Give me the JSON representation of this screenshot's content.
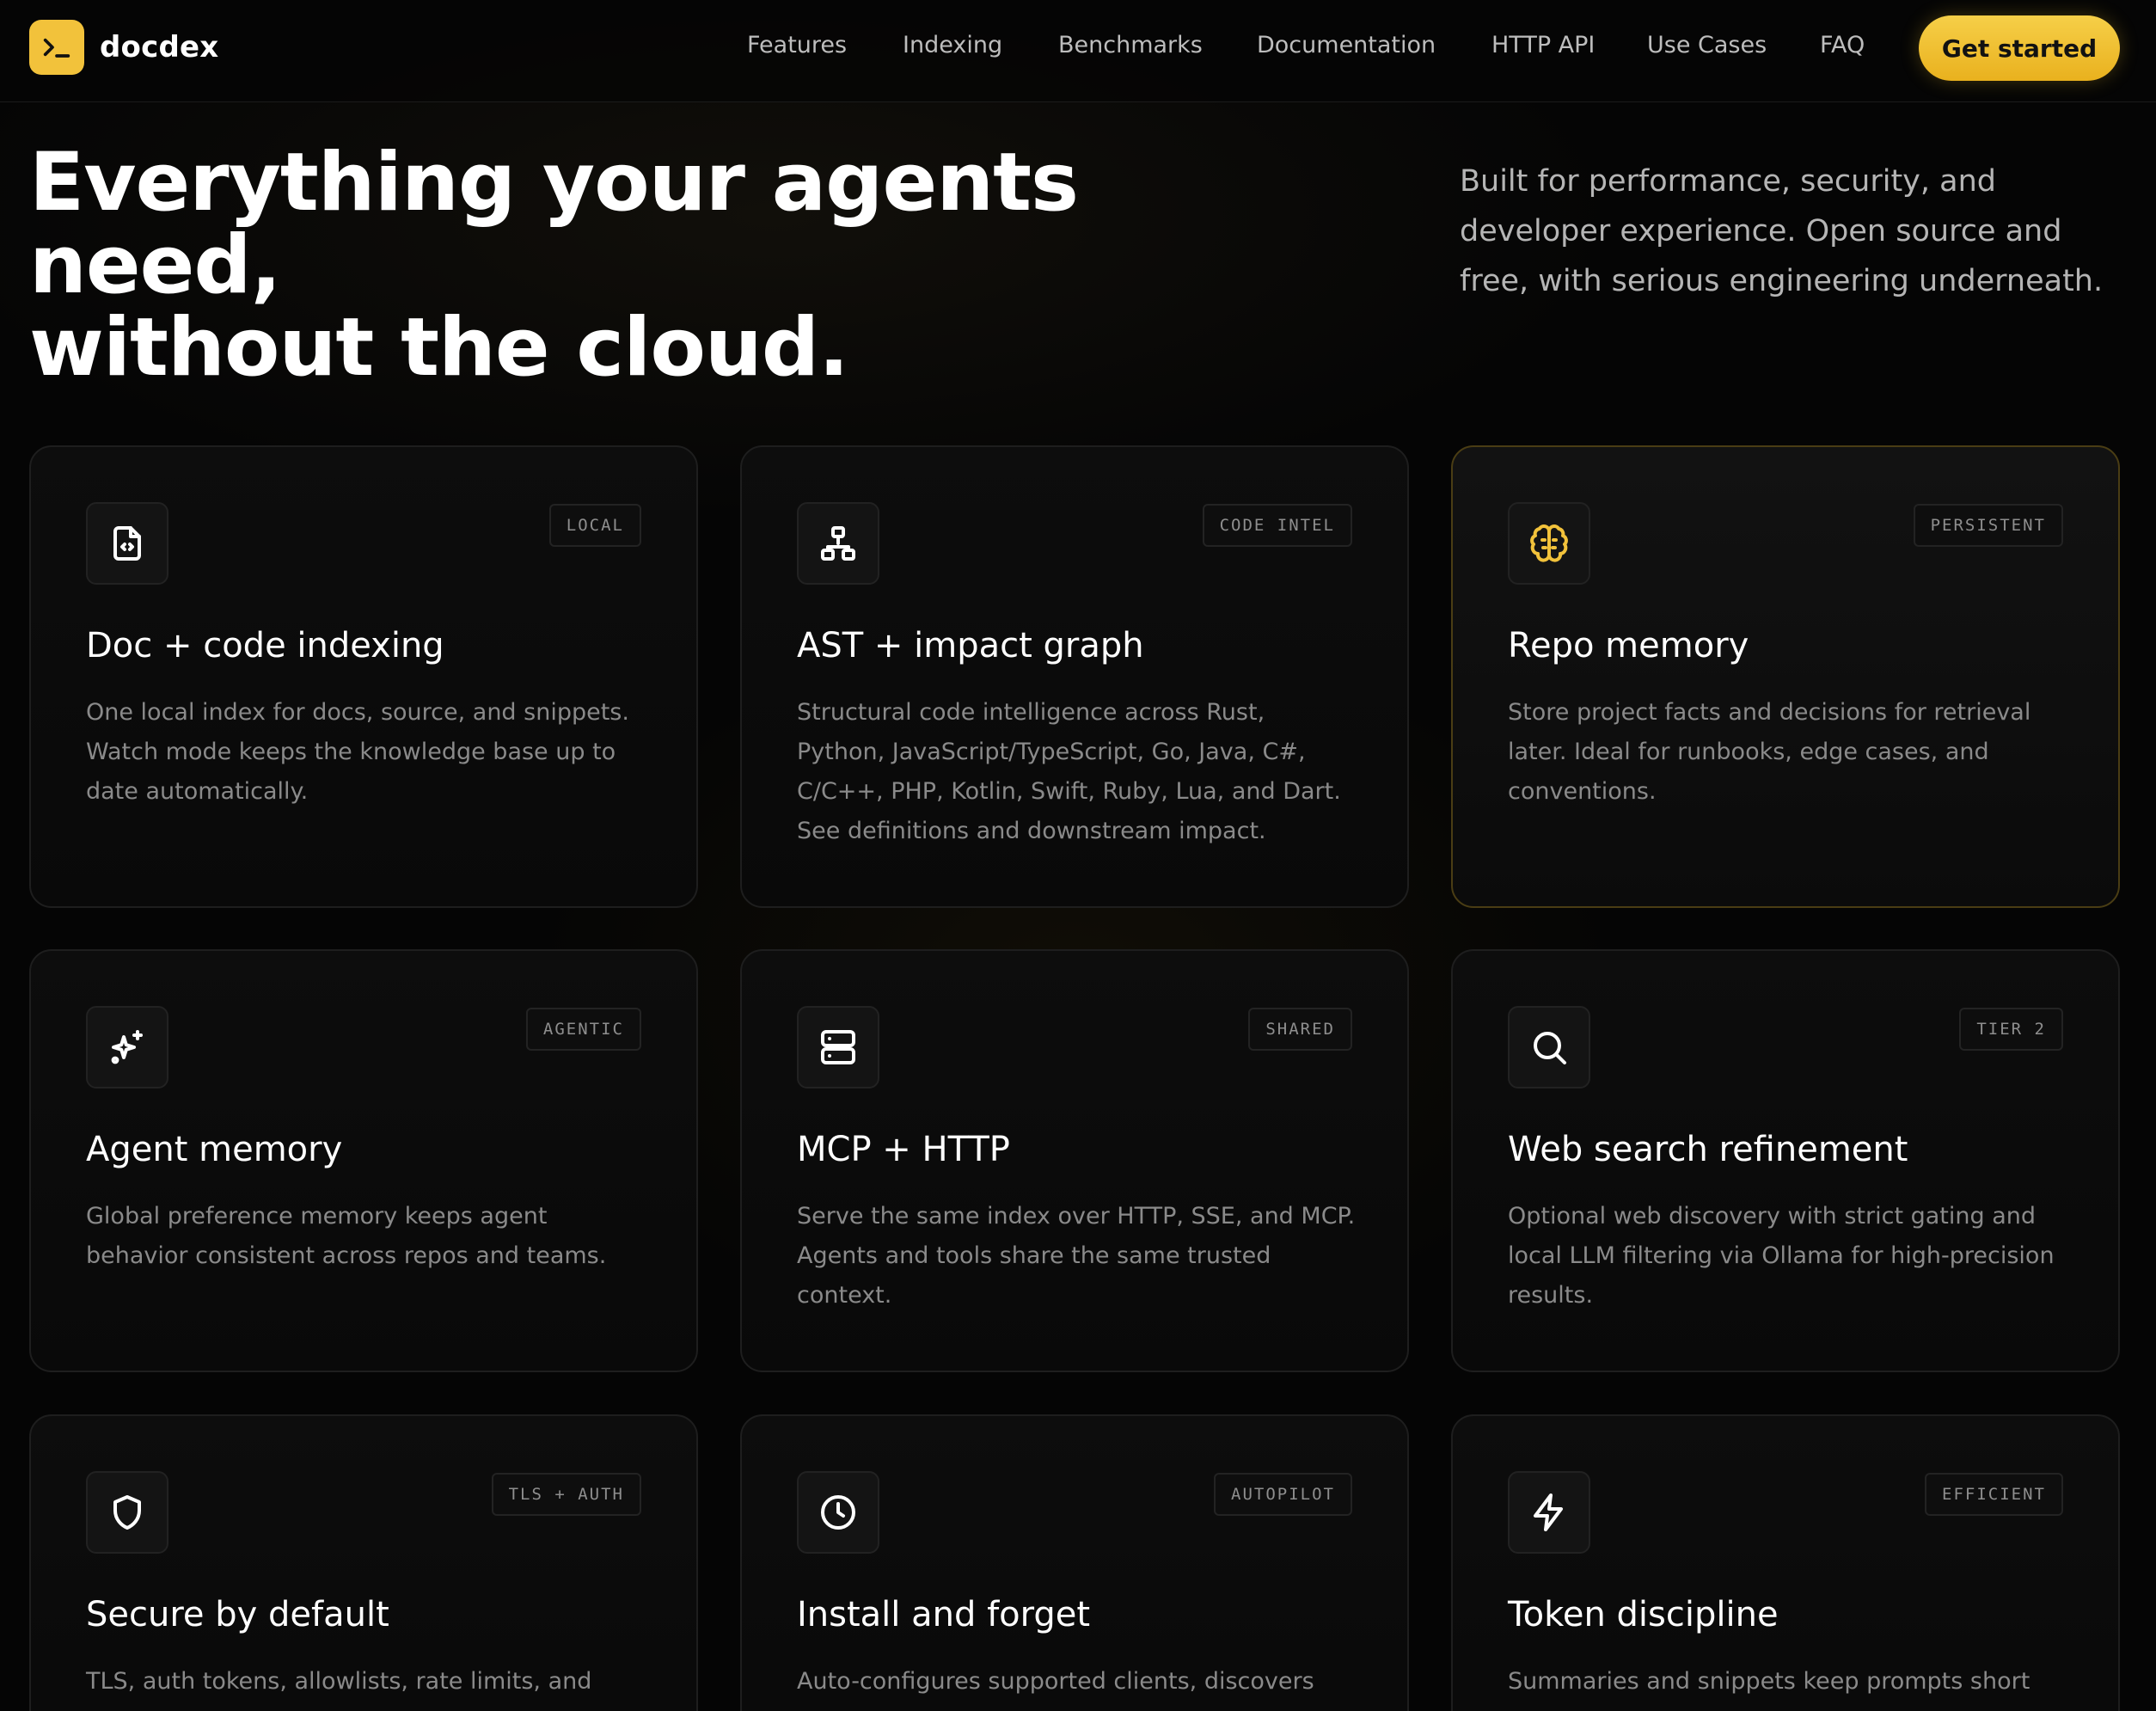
{
  "brand": {
    "name": "docdex",
    "logo_icon": "terminal-prompt-icon",
    "accent": "#f2c23b"
  },
  "nav": {
    "links": [
      "Features",
      "Indexing",
      "Benchmarks",
      "Documentation",
      "HTTP API",
      "Use Cases",
      "FAQ"
    ],
    "cta": "Get started"
  },
  "hero": {
    "title_line1": "Everything your agents need,",
    "title_line2": "without the cloud.",
    "subtitle": "Built for performance, security, and developer experience. Open source and free, with serious engineering underneath."
  },
  "features": [
    {
      "icon": "file-code-icon",
      "tag": "LOCAL",
      "title": "Doc + code indexing",
      "description": "One local index for docs, source, and snippets. Watch mode keeps the knowledge base up to date automatically."
    },
    {
      "icon": "network-tree-icon",
      "tag": "CODE INTEL",
      "title": "AST + impact graph",
      "description": "Structural code intelligence across Rust, Python, JavaScript/TypeScript, Go, Java, C#, C/C++, PHP, Kotlin, Swift, Ruby, Lua, and Dart. See definitions and downstream impact."
    },
    {
      "icon": "brain-icon",
      "tag": "PERSISTENT",
      "title": "Repo memory",
      "description": "Store project facts and decisions for retrieval later. Ideal for runbooks, edge cases, and conventions."
    },
    {
      "icon": "sparkles-icon",
      "tag": "AGENTIC",
      "title": "Agent memory",
      "description": "Global preference memory keeps agent behavior consistent across repos and teams."
    },
    {
      "icon": "server-icon",
      "tag": "SHARED",
      "title": "MCP + HTTP",
      "description": "Serve the same index over HTTP, SSE, and MCP. Agents and tools share the same trusted context."
    },
    {
      "icon": "search-icon",
      "tag": "TIER 2",
      "title": "Web search refinement",
      "description": "Optional web discovery with strict gating and local LLM filtering via Ollama for high-precision results."
    },
    {
      "icon": "shield-icon",
      "tag": "TLS + AUTH",
      "title": "Secure by default",
      "description": "TLS, auth tokens, allowlists, rate limits, and"
    },
    {
      "icon": "clock-icon",
      "tag": "AUTOPILOT",
      "title": "Install and forget",
      "description": "Auto-configures supported clients, discovers"
    },
    {
      "icon": "lightning-icon",
      "tag": "EFFICIENT",
      "title": "Token discipline",
      "description": "Summaries and snippets keep prompts short"
    }
  ]
}
